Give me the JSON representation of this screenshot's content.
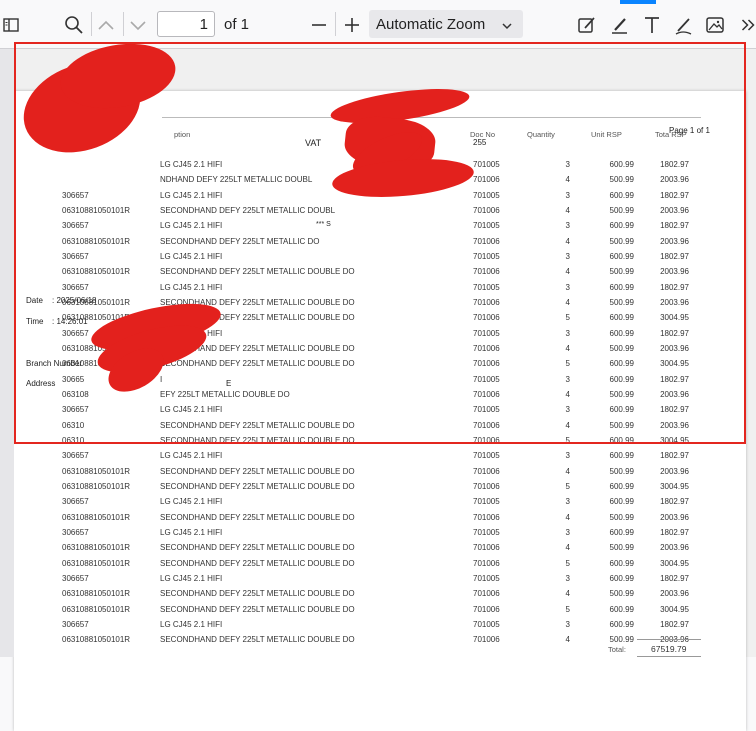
{
  "toolbar": {
    "page_number": "1",
    "page_count_label": "of 1",
    "zoom_label": "Automatic Zoom",
    "accent_color": "#0a84ff"
  },
  "report": {
    "page_label": "Page 1 of 1",
    "vat_label": "VAT",
    "vat_fragment": "255",
    "stars_fragment": "*** S",
    "date_label": "Date",
    "date_value": ": 2025/06/18",
    "time_label": "Time",
    "time_value": ": 14:26:01",
    "branch_label": "Branch Number",
    "address_label": "Address",
    "address_fragment": "E",
    "total_label": "Total:",
    "total_value": "67519.79",
    "columns": {
      "description": "ption",
      "doc_no": "Doc No",
      "quantity": "Quantity",
      "unit_rsp": "Unit RSP",
      "total_rsp": "Tota RSP"
    },
    "rows": [
      {
        "code": "",
        "desc": "LG CJ45 2.1 HIFI",
        "doc": "701005",
        "qty": "3",
        "unit": "600.99",
        "total": "1802.97"
      },
      {
        "code": "",
        "desc": "NDHAND DEFY 225LT METALLIC DOUBL",
        "doc": "701006",
        "qty": "4",
        "unit": "500.99",
        "total": "2003.96"
      },
      {
        "code": "306657",
        "desc": "LG CJ45 2.1 HIFI",
        "doc": "701005",
        "qty": "3",
        "unit": "600.99",
        "total": "1802.97"
      },
      {
        "code": "06310881050101R",
        "desc": "SECONDHAND DEFY 225LT METALLIC DOUBL",
        "doc": "701006",
        "qty": "4",
        "unit": "500.99",
        "total": "2003.96"
      },
      {
        "code": "306657",
        "desc": "LG CJ45 2.1 HIFI",
        "doc": "701005",
        "qty": "3",
        "unit": "600.99",
        "total": "1802.97"
      },
      {
        "code": "06310881050101R",
        "desc": "SECONDHAND DEFY 225LT METALLIC DO",
        "doc": "701006",
        "qty": "4",
        "unit": "500.99",
        "total": "2003.96"
      },
      {
        "code": "306657",
        "desc": "LG CJ45 2.1 HIFI",
        "doc": "701005",
        "qty": "3",
        "unit": "600.99",
        "total": "1802.97"
      },
      {
        "code": "06310881050101R",
        "desc": "SECONDHAND DEFY 225LT METALLIC DOUBLE DO",
        "doc": "701006",
        "qty": "4",
        "unit": "500.99",
        "total": "2003.96"
      },
      {
        "code": "306657",
        "desc": "LG CJ45 2.1 HIFI",
        "doc": "701005",
        "qty": "3",
        "unit": "600.99",
        "total": "1802.97"
      },
      {
        "code": "06310881050101R",
        "desc": "SECONDHAND DEFY 225LT METALLIC DOUBLE DO",
        "doc": "701006",
        "qty": "4",
        "unit": "500.99",
        "total": "2003.96"
      },
      {
        "code": "06310881050101R",
        "desc": "SECONDHAND DEFY 225LT METALLIC DOUBLE DO",
        "doc": "701006",
        "qty": "5",
        "unit": "600.99",
        "total": "3004.95"
      },
      {
        "code": "306657",
        "desc": "LG CJ45 2.1 HIFI",
        "doc": "701005",
        "qty": "3",
        "unit": "600.99",
        "total": "1802.97"
      },
      {
        "code": "06310881050101R",
        "desc": "SECONDHAND DEFY 225LT METALLIC DOUBLE DO",
        "doc": "701006",
        "qty": "4",
        "unit": "500.99",
        "total": "2003.96"
      },
      {
        "code": "06310881050101R",
        "desc": "SECONDHAND DEFY 225LT METALLIC DOUBLE DO",
        "doc": "701006",
        "qty": "5",
        "unit": "600.99",
        "total": "3004.95"
      },
      {
        "code": "30665",
        "desc": "I",
        "doc": "701005",
        "qty": "3",
        "unit": "600.99",
        "total": "1802.97"
      },
      {
        "code": "063108",
        "desc": "EFY 225LT METALLIC DOUBLE DO",
        "doc": "701006",
        "qty": "4",
        "unit": "500.99",
        "total": "2003.96"
      },
      {
        "code": "306657",
        "desc": "LG CJ45 2.1 HIFI",
        "doc": "701005",
        "qty": "3",
        "unit": "600.99",
        "total": "1802.97"
      },
      {
        "code": "06310",
        "desc": "SECONDHAND DEFY 225LT METALLIC DOUBLE DO",
        "doc": "701006",
        "qty": "4",
        "unit": "500.99",
        "total": "2003.96"
      },
      {
        "code": "06310",
        "desc": "SECONDHAND DEFY 225LT METALLIC DOUBLE DO",
        "doc": "701006",
        "qty": "5",
        "unit": "600.99",
        "total": "3004.95"
      },
      {
        "code": "306657",
        "desc": "LG CJ45 2.1 HIFI",
        "doc": "701005",
        "qty": "3",
        "unit": "600.99",
        "total": "1802.97"
      },
      {
        "code": "06310881050101R",
        "desc": "SECONDHAND DEFY 225LT METALLIC DOUBLE DO",
        "doc": "701006",
        "qty": "4",
        "unit": "500.99",
        "total": "2003.96"
      },
      {
        "code": "06310881050101R",
        "desc": "SECONDHAND DEFY 225LT METALLIC DOUBLE DO",
        "doc": "701006",
        "qty": "5",
        "unit": "600.99",
        "total": "3004.95"
      },
      {
        "code": "306657",
        "desc": "LG CJ45 2.1 HIFI",
        "doc": "701005",
        "qty": "3",
        "unit": "600.99",
        "total": "1802.97"
      },
      {
        "code": "06310881050101R",
        "desc": "SECONDHAND DEFY 225LT METALLIC DOUBLE DO",
        "doc": "701006",
        "qty": "4",
        "unit": "500.99",
        "total": "2003.96"
      },
      {
        "code": "306657",
        "desc": "LG CJ45 2.1 HIFI",
        "doc": "701005",
        "qty": "3",
        "unit": "600.99",
        "total": "1802.97"
      },
      {
        "code": "06310881050101R",
        "desc": "SECONDHAND DEFY 225LT METALLIC DOUBLE DO",
        "doc": "701006",
        "qty": "4",
        "unit": "500.99",
        "total": "2003.96"
      },
      {
        "code": "06310881050101R",
        "desc": "SECONDHAND DEFY 225LT METALLIC DOUBLE DO",
        "doc": "701006",
        "qty": "5",
        "unit": "600.99",
        "total": "3004.95"
      },
      {
        "code": "306657",
        "desc": "LG CJ45 2.1 HIFI",
        "doc": "701005",
        "qty": "3",
        "unit": "600.99",
        "total": "1802.97"
      },
      {
        "code": "06310881050101R",
        "desc": "SECONDHAND DEFY 225LT METALLIC DOUBLE DO",
        "doc": "701006",
        "qty": "4",
        "unit": "500.99",
        "total": "2003.96"
      },
      {
        "code": "06310881050101R",
        "desc": "SECONDHAND DEFY 225LT METALLIC DOUBLE DO",
        "doc": "701006",
        "qty": "5",
        "unit": "600.99",
        "total": "3004.95"
      },
      {
        "code": "306657",
        "desc": "LG CJ45 2.1 HIFI",
        "doc": "701005",
        "qty": "3",
        "unit": "600.99",
        "total": "1802.97"
      },
      {
        "code": "06310881050101R",
        "desc": "SECONDHAND DEFY 225LT METALLIC DOUBLE DO",
        "doc": "701006",
        "qty": "4",
        "unit": "500.99",
        "total": "2003.96"
      }
    ]
  }
}
